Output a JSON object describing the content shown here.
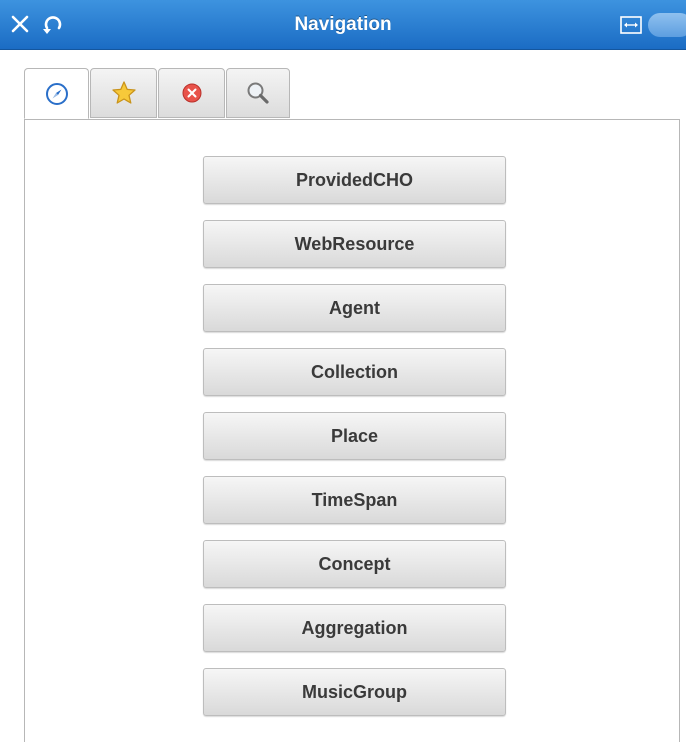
{
  "window": {
    "title": "Navigation"
  },
  "titlebar": {
    "icons": [
      "close-icon",
      "refresh-icon",
      "resize-icon",
      "toggle-switch"
    ],
    "color": "#2a7fd4"
  },
  "tabs": [
    {
      "icon": "compass-icon",
      "active": true
    },
    {
      "icon": "star-icon",
      "active": false
    },
    {
      "icon": "error-icon",
      "active": false
    },
    {
      "icon": "search-icon",
      "active": false
    }
  ],
  "nav": {
    "buttons": [
      "ProvidedCHO",
      "WebResource",
      "Agent",
      "Collection",
      "Place",
      "TimeSpan",
      "Concept",
      "Aggregation",
      "MusicGroup"
    ]
  }
}
